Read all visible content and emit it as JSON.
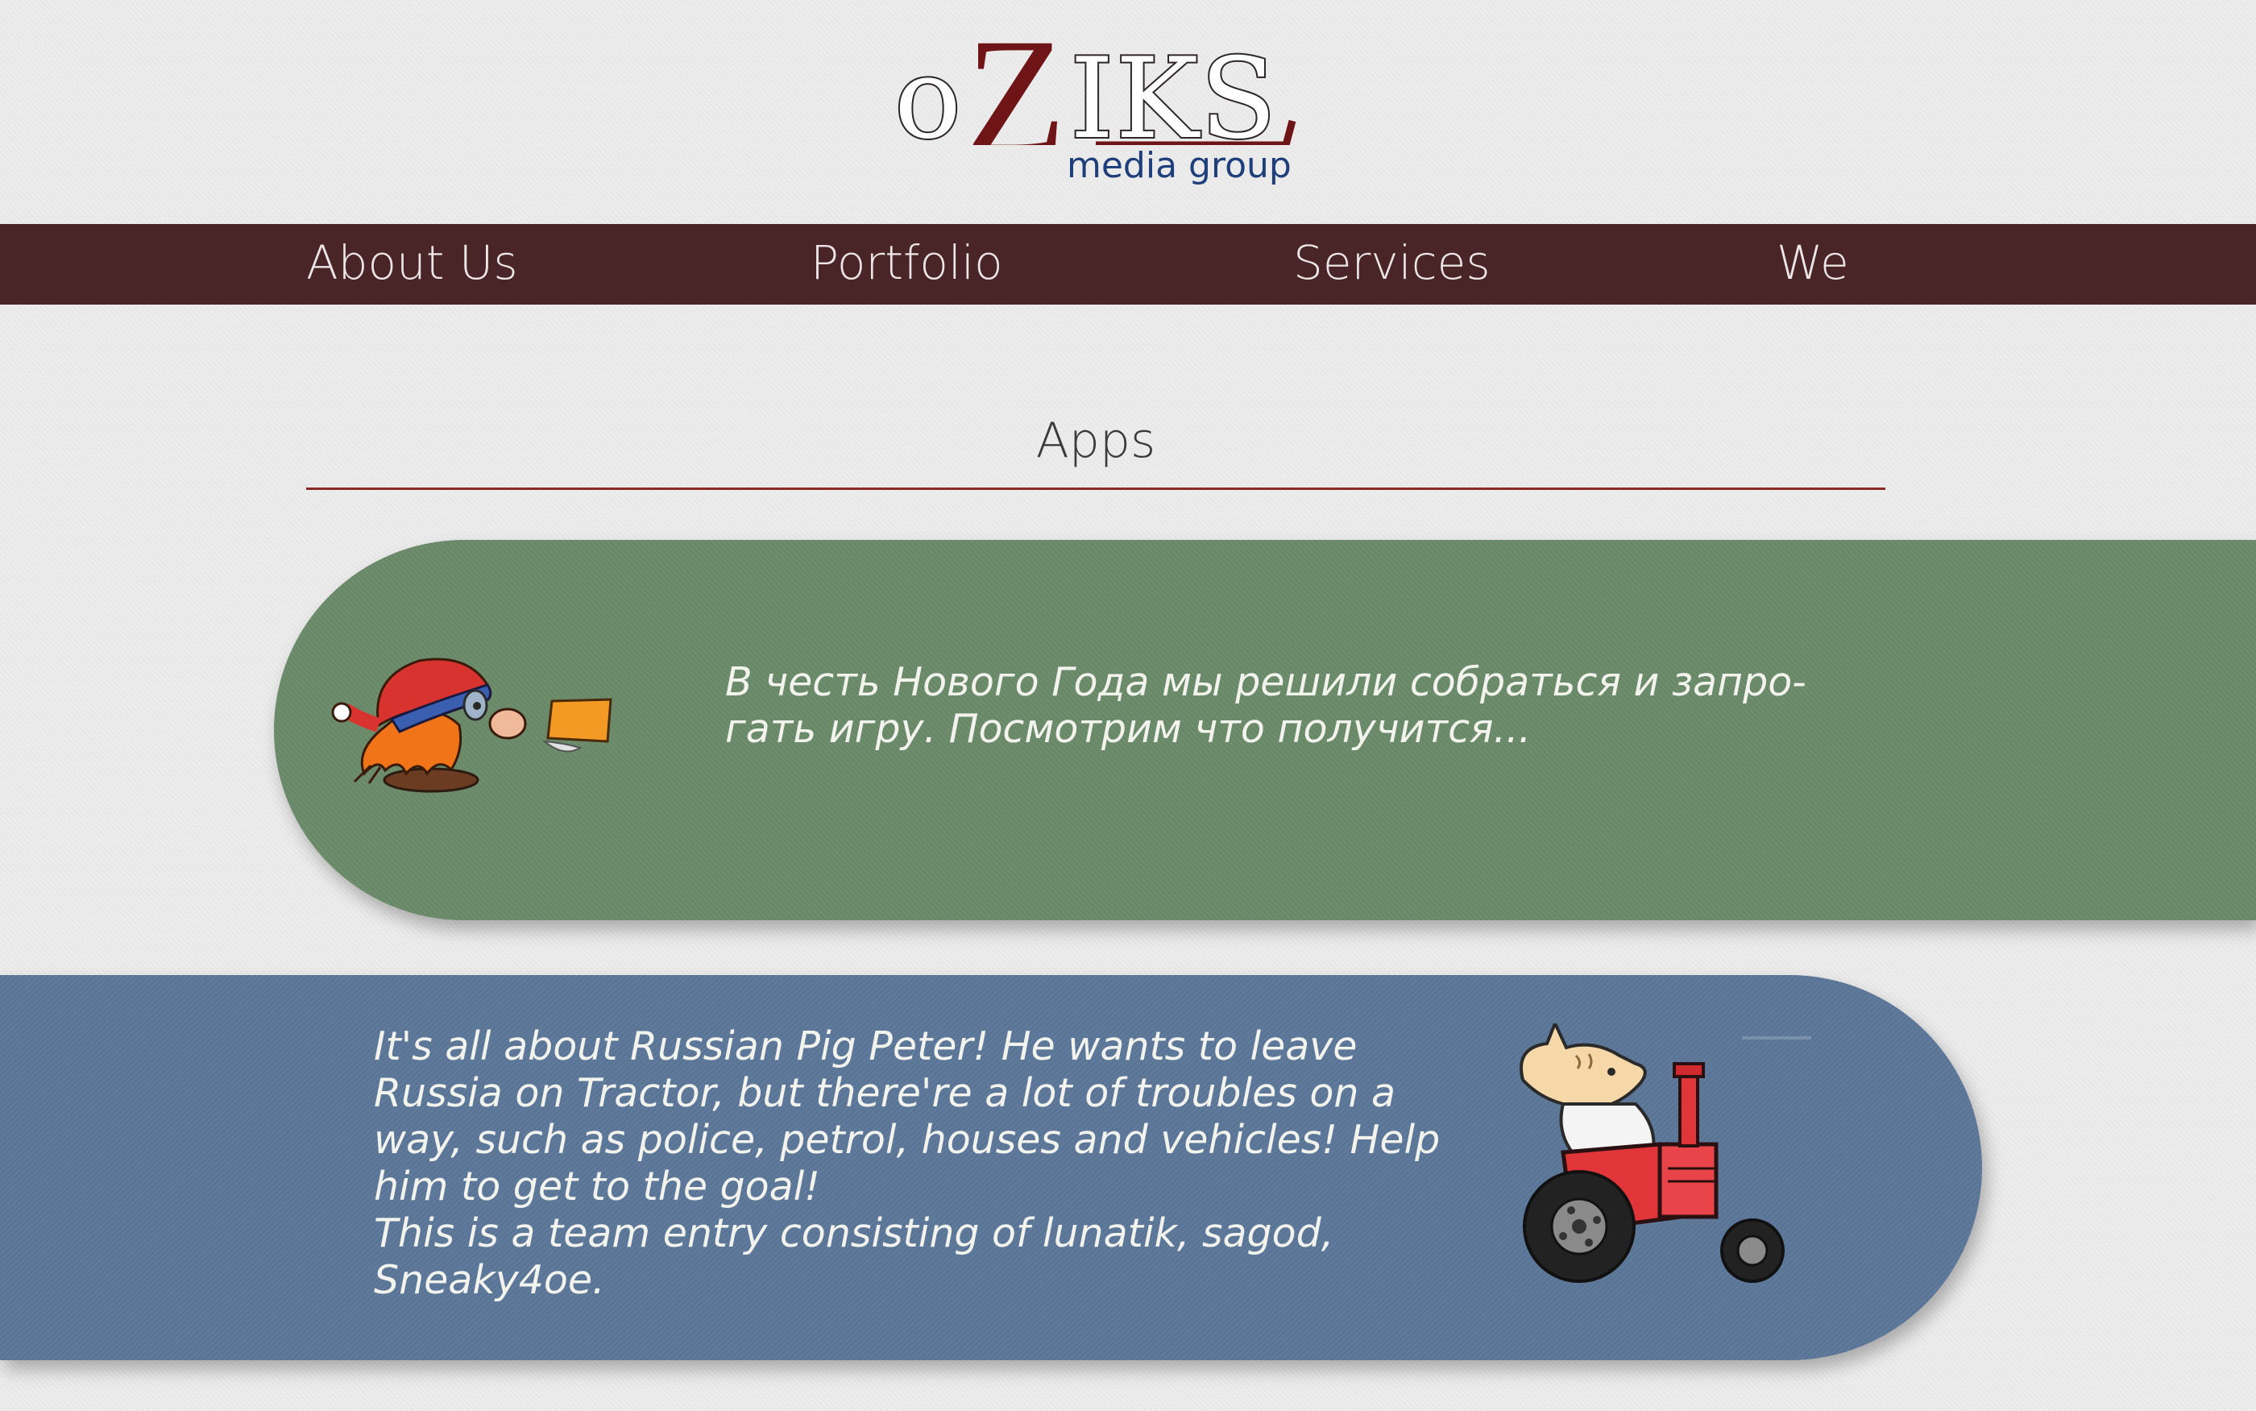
{
  "logo": {
    "letter_o": "o",
    "letter_z": "Z",
    "letters_iks": "IKS",
    "subtitle": "media group"
  },
  "nav": {
    "items": [
      "About Us",
      "Portfolio",
      "Services",
      "We"
    ]
  },
  "section": {
    "title": "Apps"
  },
  "apps": [
    {
      "color": "#6a8b6a",
      "icon": "gnome-illustration",
      "description": "В честь Нового Года мы решили собраться и запро-\nгать игру. Посмотрим что получится..."
    },
    {
      "color": "#5c7799",
      "icon": "pig-on-tractor-illustration",
      "description": "It's all about Russian Pig Peter! He wants to leave\nRussia on Tractor, but there're a lot of troubles on a\nway, such as police, petrol, houses and vehicles! Help\nhim to get to the goal!\nThis is a team entry consisting of lunatik, sagod,\nSneaky4oe."
    }
  ],
  "colors": {
    "nav_background": "#4a2527",
    "logo_accent": "#6f1517",
    "logo_subtitle": "#1f3f7a",
    "divider": "#8a2a22"
  }
}
